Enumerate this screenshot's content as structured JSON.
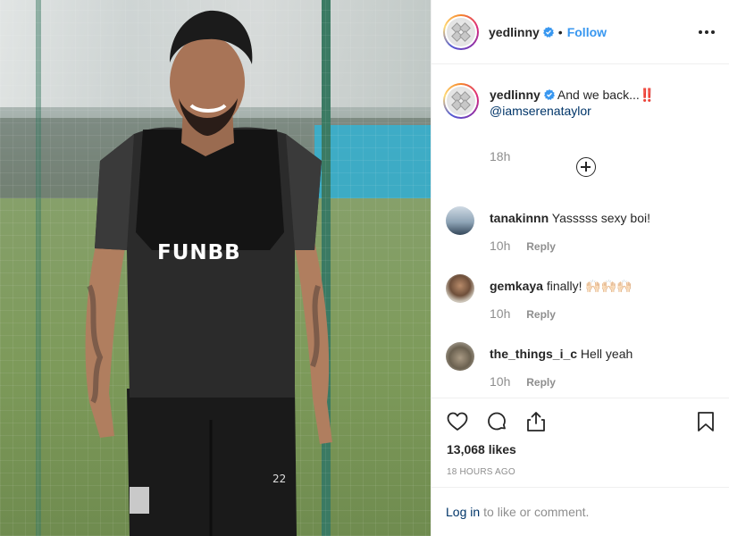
{
  "post": {
    "username": "yedlinny",
    "follow_label": "Follow",
    "dot": "•",
    "caption": {
      "username": "yedlinny",
      "text": "And we back...",
      "emoji": "‼️",
      "mention": "@iamserenataylor",
      "time": "18h"
    },
    "jersey_text": "FUNBB",
    "comments": [
      {
        "username": "tanakinnn",
        "text": "Yasssss sexy boi!",
        "time": "10h",
        "reply": "Reply"
      },
      {
        "username": "gemkaya",
        "text": "finally! 🙌🏻🙌🏻🙌🏻",
        "time": "10h",
        "reply": "Reply"
      },
      {
        "username": "the_things_i_c",
        "text": "Hell yeah",
        "time": "10h",
        "reply": "Reply"
      }
    ],
    "likes": "13,068 likes",
    "time_ago": "18 HOURS AGO",
    "footer": {
      "login_label": "Log in",
      "suffix": "to like or comment."
    }
  },
  "icons": {
    "verified": "verified-badge-icon",
    "more": "more-options-icon",
    "load_more": "plus-circle-icon",
    "like": "heart-icon",
    "comment": "comment-bubble-icon",
    "share": "share-icon",
    "save": "bookmark-icon"
  },
  "colors": {
    "link_blue": "#3897f0",
    "mention_blue": "#003569",
    "text": "#262626",
    "muted": "#8e8e8e",
    "border": "#efefef"
  }
}
